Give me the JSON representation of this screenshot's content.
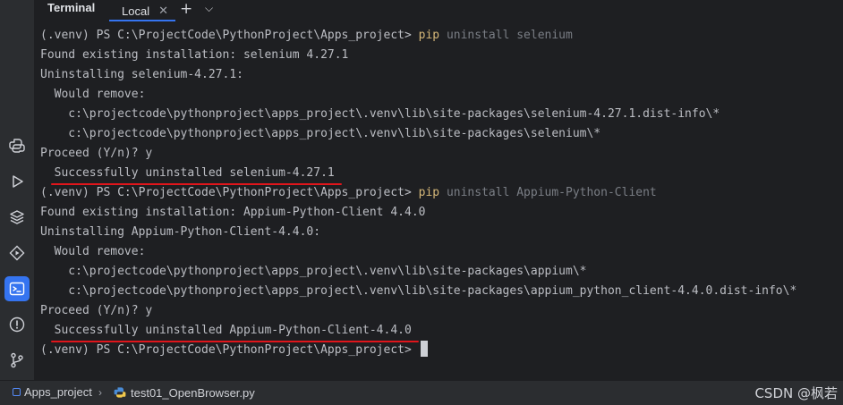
{
  "tab_header": {
    "title": "Terminal",
    "tabs": [
      {
        "label": "Local",
        "close": "✕"
      }
    ],
    "add_label": "+",
    "dropdown_label": "⌵"
  },
  "terminal": {
    "prompt": "(.venv) PS C:\\ProjectCode\\PythonProject\\Apps_project> ",
    "lines": [
      {
        "kind": "command",
        "pip": "pip",
        "args": " uninstall selenium"
      },
      {
        "kind": "text",
        "text": "Found existing installation: selenium 4.27.1"
      },
      {
        "kind": "text",
        "text": "Uninstalling selenium-4.27.1:"
      },
      {
        "kind": "text",
        "text": "  Would remove:"
      },
      {
        "kind": "text",
        "text": "    c:\\projectcode\\pythonproject\\apps_project\\.venv\\lib\\site-packages\\selenium-4.27.1.dist-info\\*"
      },
      {
        "kind": "text",
        "text": "    c:\\projectcode\\pythonproject\\apps_project\\.venv\\lib\\site-packages\\selenium\\*"
      },
      {
        "kind": "text",
        "text": "Proceed (Y/n)? y"
      },
      {
        "kind": "success",
        "text": "Successfully uninstalled selenium-4.27.1"
      },
      {
        "kind": "command",
        "pip": "pip",
        "args": " uninstall Appium-Python-Client"
      },
      {
        "kind": "text",
        "text": "Found existing installation: Appium-Python-Client 4.4.0"
      },
      {
        "kind": "text",
        "text": "Uninstalling Appium-Python-Client-4.4.0:"
      },
      {
        "kind": "text",
        "text": "  Would remove:"
      },
      {
        "kind": "text",
        "text": "    c:\\projectcode\\pythonproject\\apps_project\\.venv\\lib\\site-packages\\appium\\*"
      },
      {
        "kind": "text",
        "text": "    c:\\projectcode\\pythonproject\\apps_project\\.venv\\lib\\site-packages\\appium_python_client-4.4.0.dist-info\\*"
      },
      {
        "kind": "text",
        "text": "Proceed (Y/n)? y"
      },
      {
        "kind": "success",
        "text": "Successfully uninstalled Appium-Python-Client-4.4.0"
      },
      {
        "kind": "prompt_only"
      }
    ]
  },
  "left_strip": {
    "icons": [
      "python-console-icon",
      "run-icon",
      "python-packages-icon",
      "services-icon",
      "terminal-icon",
      "problems-icon",
      "git-icon"
    ],
    "active": "terminal-icon"
  },
  "status_bar": {
    "project": "Apps_project",
    "file": "test01_OpenBrowser.py",
    "watermark": "CSDN @枫若"
  },
  "colors": {
    "background": "#1e1f22",
    "panel": "#2b2d30",
    "accent": "#3574f0",
    "pip_keyword": "#d5b778",
    "underline": "#e0151b"
  }
}
